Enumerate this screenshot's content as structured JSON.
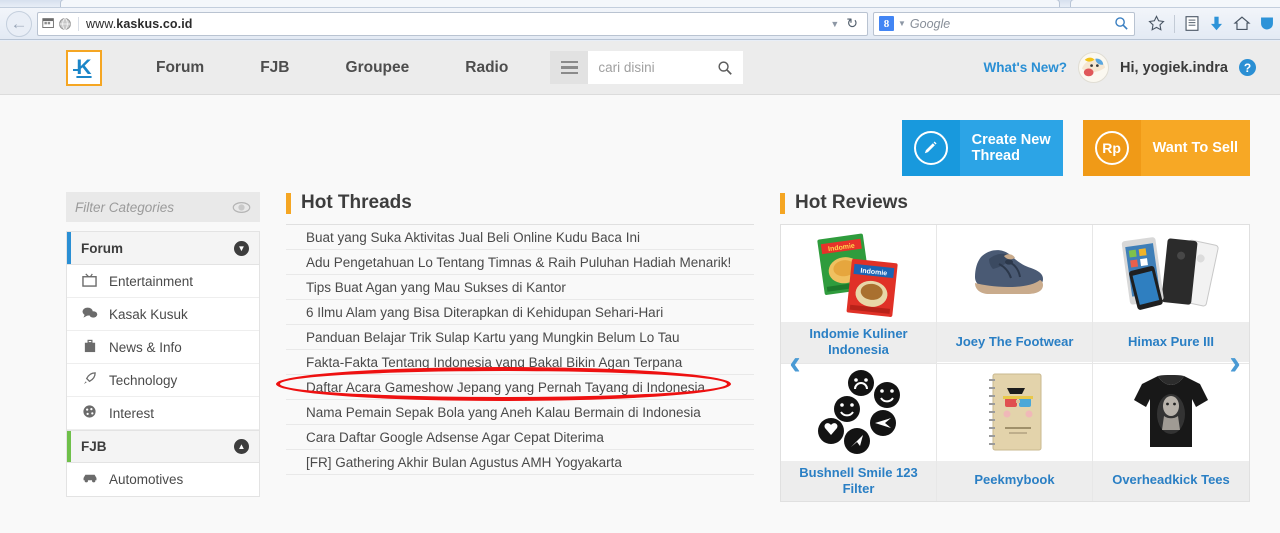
{
  "browser": {
    "url": "www.kaskus.co.id",
    "url_prefix": "www.",
    "url_domain": "kaskus.co.id",
    "search_placeholder": "Google",
    "search_engine_badge": "8",
    "back_icon": "back-arrow-icon",
    "reload_icon": "reload-icon",
    "dropdown_icon": "chevron-down-icon",
    "bookmark_icon": "star-icon",
    "readinglist_icon": "clipboard-icon",
    "download_icon": "download-arrow-icon",
    "home_icon": "home-icon",
    "pocket_icon": "pocket-shield-icon",
    "colors": {
      "chrome_bg": "#e8eef7",
      "accent_blue": "#2a8fd4"
    }
  },
  "header": {
    "logo_label": "K",
    "nav": [
      {
        "label": "Forum"
      },
      {
        "label": "FJB"
      },
      {
        "label": "Groupee"
      },
      {
        "label": "Radio"
      }
    ],
    "menu_icon": "hamburger-icon",
    "search_placeholder": "cari disini",
    "search_icon": "search-icon",
    "whats_new": "What's New?",
    "greeting": "Hi, yogiek.indra",
    "help_label": "?",
    "colors": {
      "bg": "#ececec",
      "logo_border": "#f5a623",
      "logo_text": "#1b86c8"
    }
  },
  "actions": [
    {
      "label": "Create New\nThread",
      "label_line1": "Create New",
      "label_line2": "Thread",
      "icon": "pencil-icon",
      "style": "blue",
      "color": "#2ca4e6"
    },
    {
      "label": "Want To Sell",
      "label_line1": "Want To Sell",
      "label_line2": "",
      "icon": "rupiah-icon",
      "icon_text": "Rp",
      "style": "orange",
      "color": "#f7a825"
    }
  ],
  "sidebar": {
    "filter_placeholder": "Filter Categories",
    "eye_icon": "eye-icon",
    "sections": [
      {
        "title": "Forum",
        "accent": "#2a8fd4",
        "chevron": "chevron-down-icon",
        "chevron_glyph": "▼",
        "items": [
          {
            "label": "Entertainment",
            "icon": "tv-icon",
            "glyph": "📺"
          },
          {
            "label": "Kasak Kusuk",
            "icon": "speech-bubble-icon",
            "glyph": "💬"
          },
          {
            "label": "News & Info",
            "icon": "briefcase-icon",
            "glyph": "💼"
          },
          {
            "label": "Technology",
            "icon": "rocket-icon",
            "glyph": "🚀"
          },
          {
            "label": "Interest",
            "icon": "palette-icon",
            "glyph": "🎨"
          }
        ]
      },
      {
        "title": "FJB",
        "accent": "#6fc04a",
        "chevron": "chevron-up-icon",
        "chevron_glyph": "▲",
        "items": [
          {
            "label": "Automotives",
            "icon": "car-icon",
            "glyph": "🚗"
          }
        ]
      }
    ]
  },
  "hot_threads": {
    "title": "Hot Threads",
    "accent": "#f5a623",
    "items": [
      {
        "title": "Buat yang Suka Aktivitas Jual Beli Online Kudu Baca Ini"
      },
      {
        "title": "Adu Pengetahuan Lo Tentang Timnas & Raih Puluhan Hadiah Menarik!"
      },
      {
        "title": "Tips Buat Agan yang Mau Sukses di Kantor"
      },
      {
        "title": "6 Ilmu Alam yang Bisa Diterapkan di Kehidupan Sehari-Hari"
      },
      {
        "title": "Panduan Belajar Trik Sulap Kartu yang Mungkin Belum Lo Tau"
      },
      {
        "title": "Fakta-Fakta Tentang Indonesia yang Bakal Bikin Agan Terpana"
      },
      {
        "title": "Daftar Acara Gameshow Jepang yang Pernah Tayang di Indonesia"
      },
      {
        "title": "Nama Pemain Sepak Bola yang Aneh Kalau Bermain di Indonesia"
      },
      {
        "title": "Cara Daftar Google Adsense Agar Cepat Diterima"
      },
      {
        "title": "[FR] Gathering Akhir Bulan Agustus AMH Yogyakarta"
      }
    ],
    "annotation": {
      "shape": "ellipse",
      "color": "#ee1111",
      "target_item_index": 5,
      "target_text": "Fakta-Fakta Tentang Indonesia yang Bakal Bikin Agan Terpana"
    }
  },
  "hot_reviews": {
    "title": "Hot Reviews",
    "accent": "#f5a623",
    "prev_icon": "chevron-left-icon",
    "next_icon": "chevron-right-icon",
    "prev_glyph": "‹",
    "next_glyph": "›",
    "items": [
      {
        "label": "Indomie Kuliner Indonesia",
        "image": "instant-noodle-packs-image"
      },
      {
        "label": "Joey The Footwear",
        "image": "blue-sneaker-shoes-image"
      },
      {
        "label": "Himax Pure III",
        "image": "smartphones-image"
      },
      {
        "label": "Bushnell Smile 123 Filter",
        "image": "black-emoji-badges-image"
      },
      {
        "label": "Peekmybook",
        "image": "spiral-notebook-image"
      },
      {
        "label": "Overheadkick Tees",
        "image": "black-tshirt-image"
      }
    ]
  }
}
